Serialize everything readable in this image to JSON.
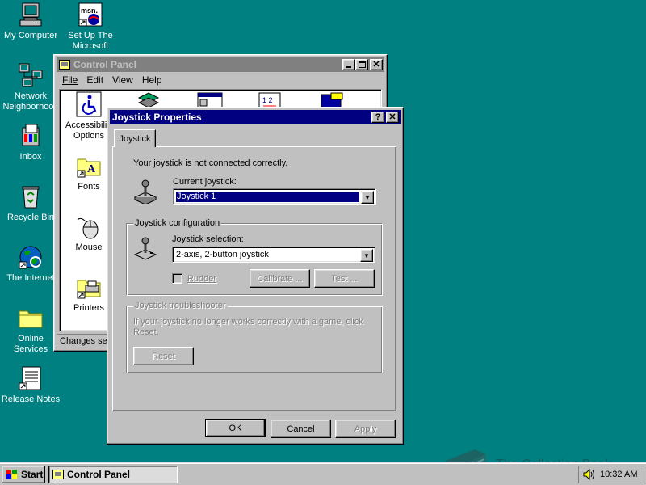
{
  "desktop": {
    "icons": [
      {
        "label": "My Computer",
        "icon": "my-computer-icon"
      },
      {
        "label": "Set Up The Microsoft",
        "icon": "msn-setup-icon"
      },
      {
        "label": "Network Neighborhood",
        "icon": "network-icon"
      },
      {
        "label": "Inbox",
        "icon": "inbox-icon"
      },
      {
        "label": "Recycle Bin",
        "icon": "recycle-bin-icon"
      },
      {
        "label": "The Internet",
        "icon": "internet-icon"
      },
      {
        "label": "Online Services",
        "icon": "folder-icon"
      },
      {
        "label": "Release Notes",
        "icon": "notepad-icon"
      }
    ],
    "background_color": "#008080"
  },
  "control_panel": {
    "title": "Control Panel",
    "menu": [
      "File",
      "Edit",
      "View",
      "Help"
    ],
    "items": [
      {
        "label": "Accessibility Options",
        "icon": "accessibility-icon"
      },
      {
        "label": "Fonts",
        "icon": "fonts-folder-icon"
      },
      {
        "label": "Mouse",
        "icon": "mouse-icon"
      },
      {
        "label": "Printers",
        "icon": "printers-icon"
      }
    ],
    "status": "Changes set"
  },
  "dialog": {
    "title": "Joystick Properties",
    "help_btn": "?",
    "close_btn": "✕",
    "tab": "Joystick",
    "status_text": "Your joystick is not connected correctly.",
    "current_label": "Current joystick:",
    "current_value": "Joystick 1",
    "config_group": "Joystick configuration",
    "selection_label": "Joystick selection:",
    "selection_value": "2-axis, 2-button joystick",
    "rudder_label": "Rudder",
    "calibrate_btn": "Calibrate ...",
    "test_btn": "Test ...",
    "trouble_group": "Joystick troubleshooter",
    "trouble_text": "If your joystick no longer works correctly with a game, click Reset.",
    "reset_btn": "Reset",
    "ok_btn": "OK",
    "cancel_btn": "Cancel",
    "apply_btn": "Apply"
  },
  "taskbar": {
    "start": "Start",
    "task": "Control Panel",
    "clock": "10:32 AM"
  },
  "watermark": "The Collection Book",
  "colors": {
    "title_active": "#000080",
    "title_inactive": "#808080",
    "face": "#c0c0c0"
  }
}
